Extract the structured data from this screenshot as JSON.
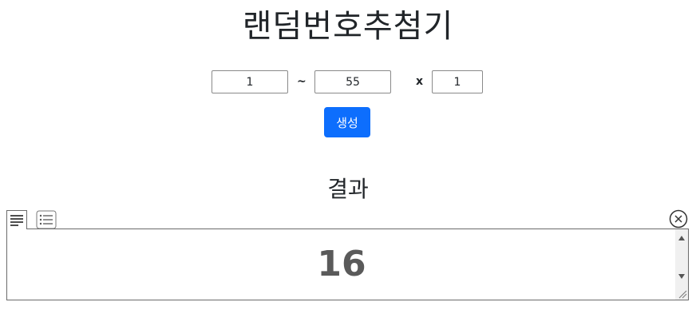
{
  "header": {
    "title": "랜덤번호추첨기"
  },
  "range": {
    "min_value": "1",
    "separator": "~",
    "max_value": "55",
    "times_symbol": "x",
    "count_value": "1"
  },
  "generate_button": {
    "label": "생성"
  },
  "result": {
    "title": "결과",
    "value": "16",
    "view_icons": [
      "text-view-icon",
      "list-view-icon"
    ],
    "close_icon": "close-circle-icon"
  },
  "colors": {
    "primary_button": "#0d6efd",
    "result_text": "#5a5a5a"
  }
}
